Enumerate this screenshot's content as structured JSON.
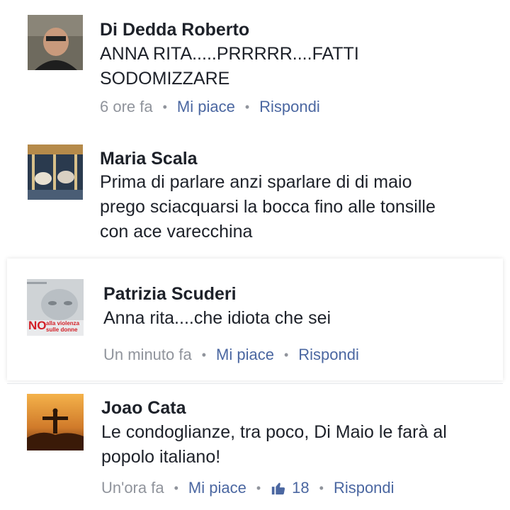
{
  "comments": [
    {
      "name": "Di Dedda Roberto",
      "text": "ANNA RITA.....PRRRRR....FATTI SODOMIZZARE",
      "time": "6 ore fa",
      "like_label": "Mi piace",
      "reply_label": "Rispondi"
    },
    {
      "name": "Maria Scala",
      "text": "Prima di parlare anzi sparlare di di maio prego sciacquarsi la bocca fino alle tonsille con ace varecchina"
    },
    {
      "name": "Patrizia Scuderi",
      "text": "Anna rita....che idiota che sei",
      "time": "Un minuto fa",
      "like_label": "Mi piace",
      "reply_label": "Rispondi",
      "avatar_text_no": "NO",
      "avatar_text_rest": "alla violenza sulle donne"
    },
    {
      "name": "Joao Cata",
      "text": "Le condoglianze, tra poco, Di Maio le farà al popolo italiano!",
      "time": "Un'ora fa",
      "like_label": "Mi piace",
      "like_count": "18",
      "reply_label": "Rispondi"
    }
  ],
  "colors": {
    "link": "#4b67a1",
    "meta": "#90949c",
    "name": "#1d2129"
  },
  "icons": {
    "like": "thumbs-up-icon"
  }
}
